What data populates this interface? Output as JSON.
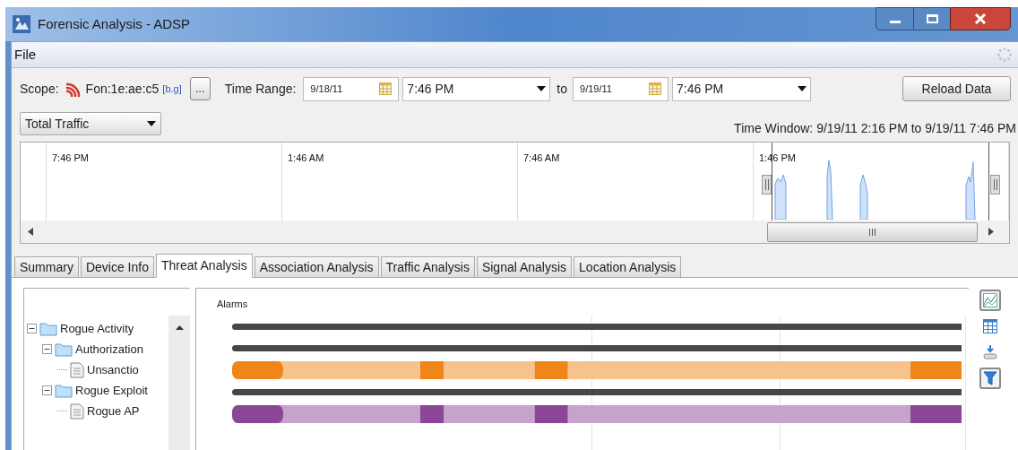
{
  "window": {
    "title": "Forensic Analysis - ADSP"
  },
  "menu": [
    "File"
  ],
  "toolbar": {
    "scope_label": "Scope:",
    "device": "Fon:1e:ae:c5",
    "band": "[b.g]",
    "browse_button": "...",
    "time_range_label": "Time Range:",
    "from_date": "9/18/11",
    "from_time": "7:46 PM",
    "to_label": "to",
    "to_date": "9/19/11",
    "to_time": "7:46 PM",
    "reload_button": "Reload Data"
  },
  "metric_select": "Total Traffic",
  "time_window": "Time Window: 9/19/11 2:16 PM to 9/19/11 7:46 PM",
  "timeline": {
    "labels": [
      "7:46 PM",
      "1:46 AM",
      "7:46 AM",
      "1:46 PM"
    ]
  },
  "tabs": [
    {
      "label": "Summary",
      "selected": false
    },
    {
      "label": "Device Info",
      "selected": false
    },
    {
      "label": "Threat Analysis",
      "selected": true
    },
    {
      "label": "Association Analysis",
      "selected": false
    },
    {
      "label": "Traffic Analysis",
      "selected": false
    },
    {
      "label": "Signal Analysis",
      "selected": false
    },
    {
      "label": "Location Analysis",
      "selected": false
    }
  ],
  "tree": [
    {
      "label": "Rogue Activity",
      "kind": "folder",
      "expanded": true,
      "children": [
        {
          "label": "Authorization",
          "kind": "folder",
          "expanded": true,
          "children": [
            {
              "label": "Unsanctio",
              "kind": "document"
            }
          ]
        },
        {
          "label": "Rogue Exploit",
          "kind": "folder",
          "expanded": true,
          "children": [
            {
              "label": "Rogue AP",
              "kind": "document"
            }
          ]
        }
      ]
    }
  ],
  "alarms": {
    "title": "Alarms",
    "rows": [
      {
        "kind": "line",
        "color": "#474747"
      },
      {
        "kind": "line",
        "color": "#474747"
      },
      {
        "kind": "band",
        "color": "#f08519"
      },
      {
        "kind": "line",
        "color": "#474747"
      },
      {
        "kind": "band",
        "color": "#8c4697"
      }
    ]
  },
  "tools": [
    {
      "kind": "chart",
      "selected": true
    },
    {
      "kind": "table",
      "selected": false
    },
    {
      "kind": "export",
      "selected": false
    },
    {
      "kind": "filter",
      "selected": true
    }
  ]
}
